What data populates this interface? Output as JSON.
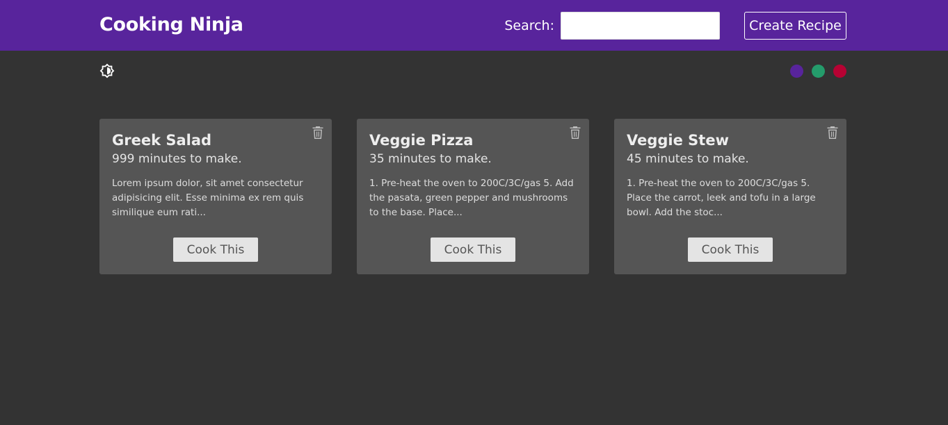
{
  "navbar": {
    "brand": "Cooking Ninja",
    "search_label": "Search:",
    "search_value": "",
    "search_placeholder": "",
    "create_label": "Create Recipe",
    "background": "#58249c"
  },
  "theme": {
    "mode_icon": "brightness-contrast-icon",
    "swatches": [
      {
        "name": "purple",
        "color": "#58249c"
      },
      {
        "name": "green",
        "color": "#249c6b"
      },
      {
        "name": "red",
        "color": "#b70233"
      }
    ]
  },
  "recipes": [
    {
      "title": "Greek Salad",
      "time": "999 minutes to make.",
      "description": "Lorem ipsum dolor, sit amet consectetur adipisicing elit. Esse minima ex rem quis similique eum rati...",
      "button": "Cook This",
      "delete_icon": "trash-icon"
    },
    {
      "title": "Veggie Pizza",
      "time": "35 minutes to make.",
      "description": "1. Pre-heat the oven to 200C/3C/gas 5. Add the pasata, green pepper and mushrooms to the base. Place...",
      "button": "Cook This",
      "delete_icon": "trash-icon"
    },
    {
      "title": "Veggie Stew",
      "time": "45 minutes to make.",
      "description": "1. Pre-heat the oven to 200C/3C/gas 5. Place the carrot, leek and tofu in a large bowl. Add the stoc...",
      "button": "Cook This",
      "delete_icon": "trash-icon"
    }
  ],
  "colors": {
    "page_background": "#333333",
    "card_background": "#555555",
    "button_background": "#e4e4e4"
  }
}
